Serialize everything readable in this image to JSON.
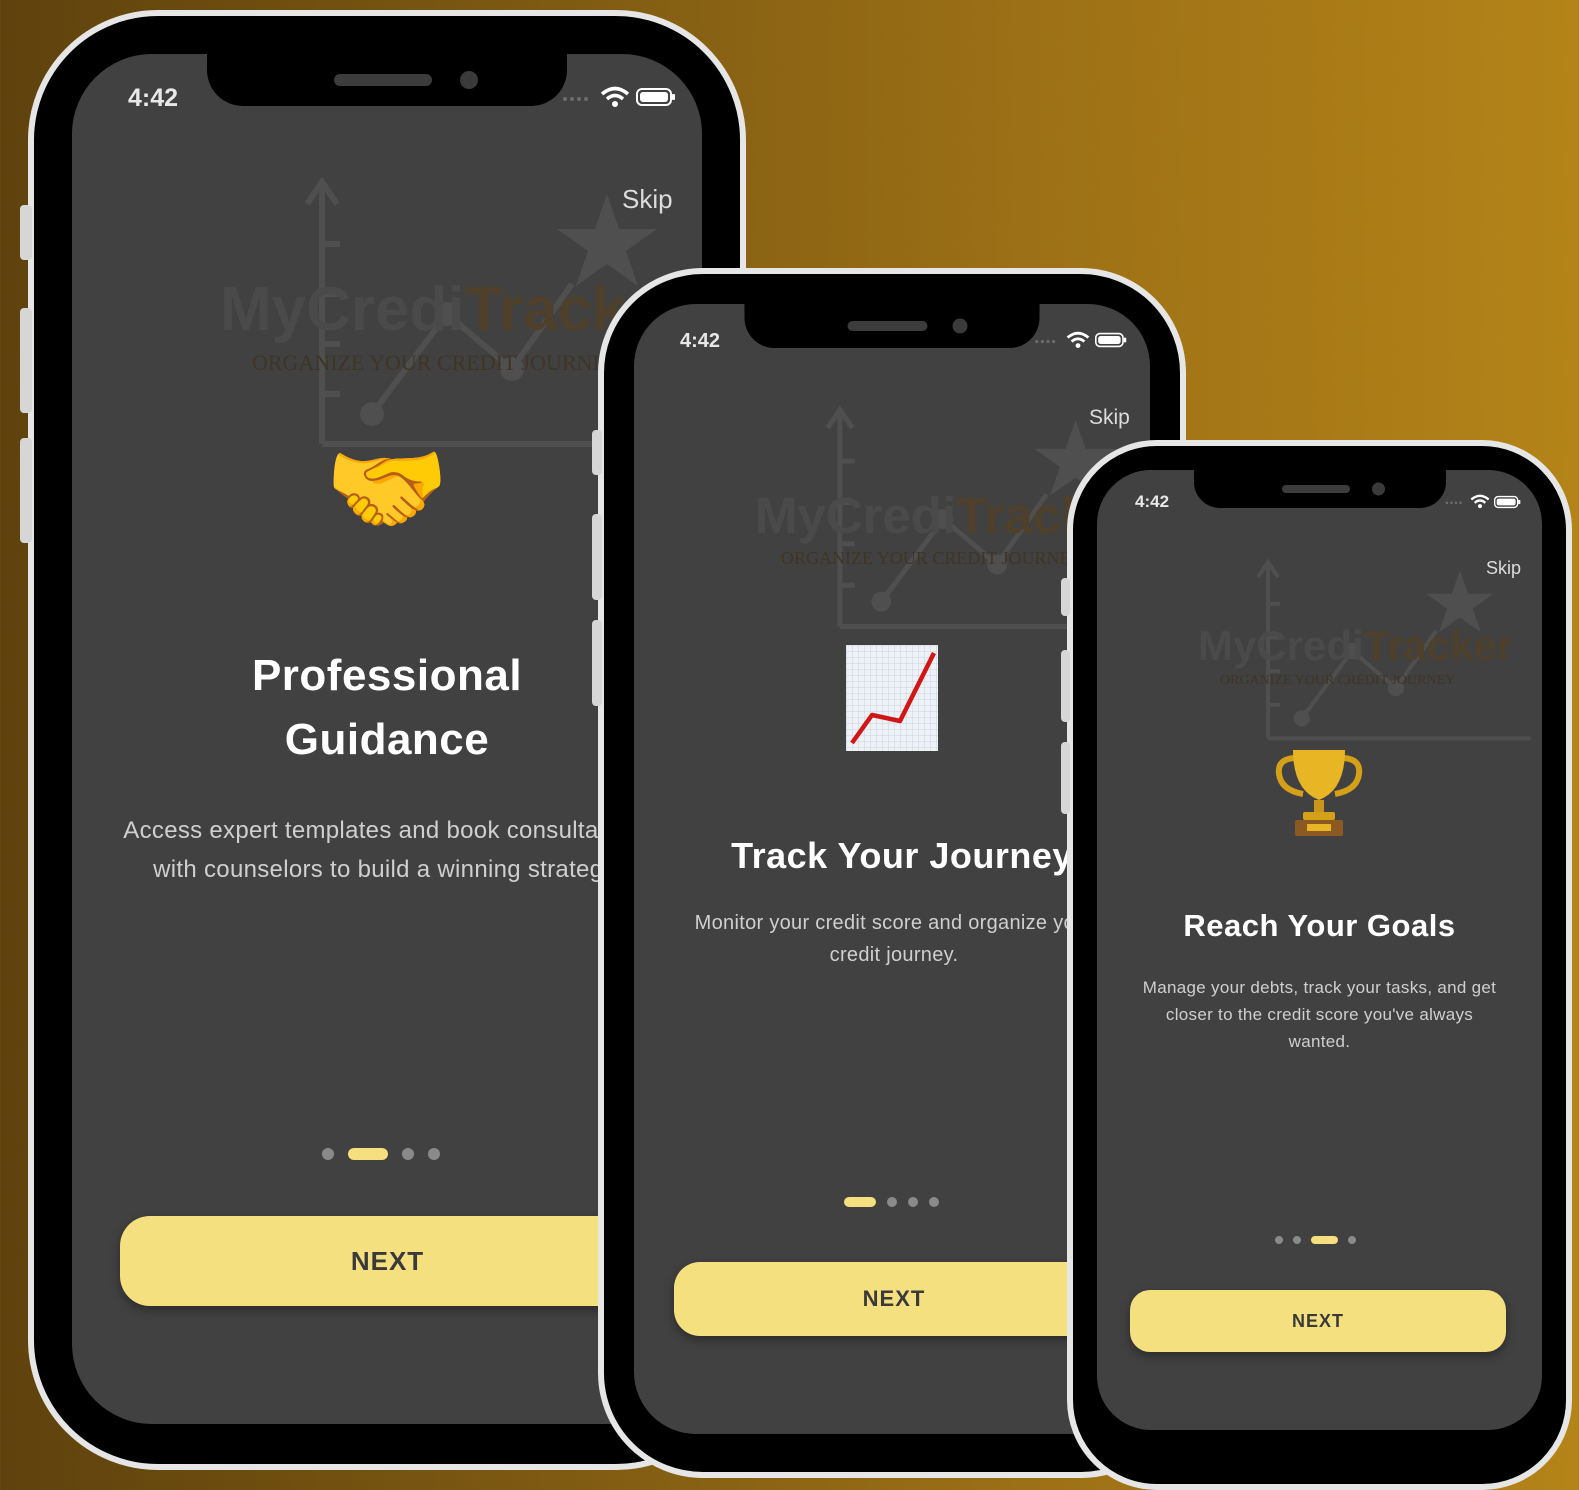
{
  "phones": [
    {
      "time": "4:42",
      "skip_label": "Skip",
      "watermark_brand_a": "MyCredi",
      "watermark_brand_b": "Tracker",
      "watermark_tagline": "ORGANIZE YOUR CREDIT JOURNEY",
      "emoji": "🤝",
      "emoji_name": "handshake-icon",
      "title": "Professional Guidance",
      "description": "Access expert templates and book consultations with counselors to build a winning strategy.",
      "active_page": 2,
      "page_count": 4,
      "next_label": "NEXT"
    },
    {
      "time": "4:42",
      "skip_label": "Skip",
      "watermark_brand_a": "MyCredi",
      "watermark_brand_b": "Tracker",
      "watermark_tagline": "ORGANIZE YOUR CREDIT JOURNEY",
      "emoji": "📈",
      "emoji_name": "chart-increasing-icon",
      "title": "Track Your Journey",
      "description": "Monitor your credit score and organize your credit journey.",
      "active_page": 1,
      "page_count": 4,
      "next_label": "NEXT"
    },
    {
      "time": "4:42",
      "skip_label": "Skip",
      "watermark_brand_a": "MyCredi",
      "watermark_brand_b": "Tracker",
      "watermark_tagline": "ORGANIZE YOUR CREDIT JOURNEY",
      "emoji": "🏆",
      "emoji_name": "trophy-icon",
      "title": "Reach Your Goals",
      "description": "Manage your debts, track your tasks, and get closer to the credit score you've always wanted.",
      "active_page": 3,
      "page_count": 4,
      "next_label": "NEXT"
    }
  ],
  "colors": {
    "accent": "#f5e07f",
    "screen_bg": "#414141",
    "dot_inactive": "#8a8a8a"
  }
}
